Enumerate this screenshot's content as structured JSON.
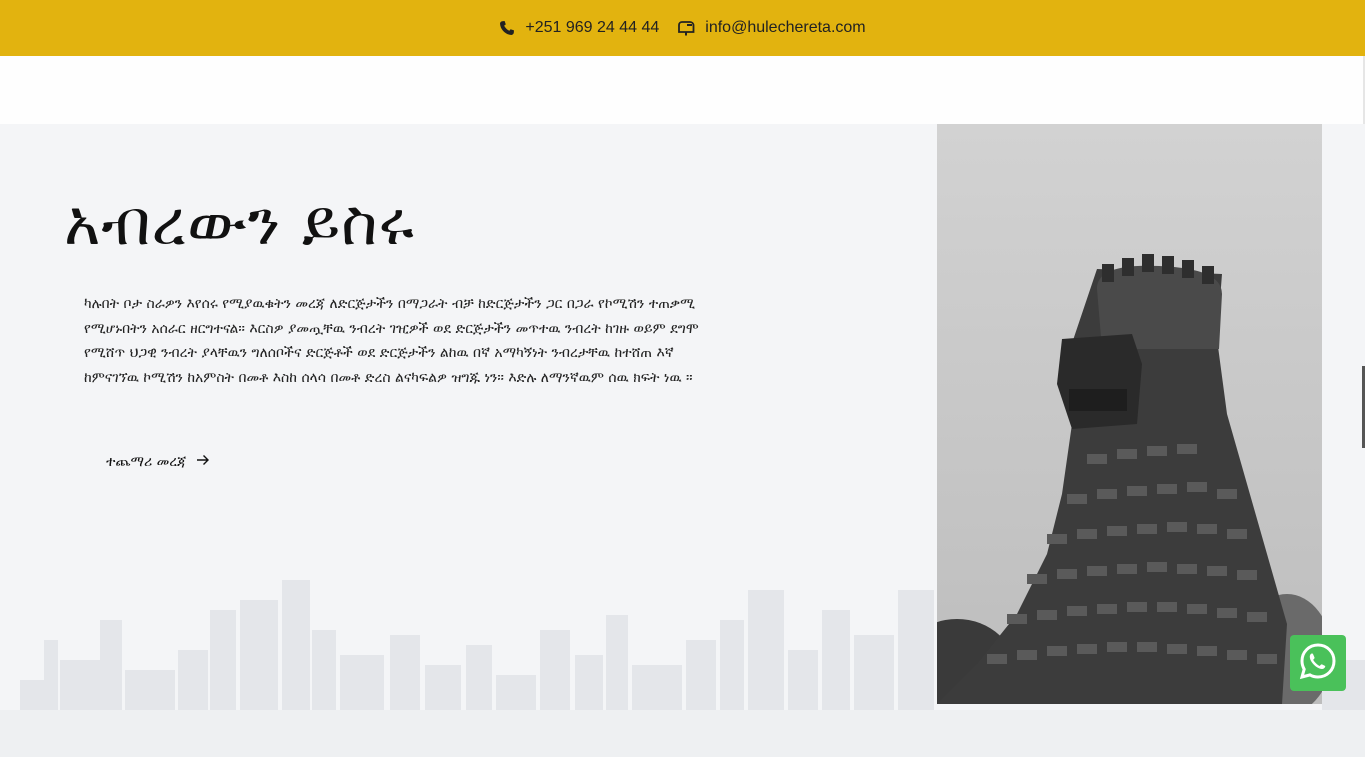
{
  "topbar": {
    "phone": "+251 969 24 44 44",
    "email": "info@hulechereta.com",
    "phone_icon": "phone-icon",
    "email_icon": "mailbox-icon",
    "background_color": "#e2b30f"
  },
  "hero": {
    "title": "አብረውን ይስሩ",
    "paragraph": "ካሉበት ቦታ ስራዎን እየሰሩ የሚያዉቁትን መረጃ ለድርጅታችን በማጋራት ብቻ ከድርጅታችን ጋር በጋራ የኮሚሽን ተጠቃሚ የሚሆኑበትን አሰራር ዘርግተናል። እርስዎ ያመጧቸዉ ንብረት ገዢዎች ወደ ድርጅታችን መጥተዉ ንብረት ከገዙ ወይም ደግሞ የሚሸጥ ህጋዊ ንብረት ያላቸዉን ግለሰቦችና ድርጅቶች ወደ ድርጅታችን ልከዉ በኛ አማካኝነት ንብረታቸዉ ከተሸጠ እኛ ከምናገኘዉ ኮሚሽን ከአምስት በመቶ እስከ ሰላሳ በመቶ ድረስ ልናካፍልዎ ዝግጁ ነን። እድሉ ለማንኛዉም ሰዉ ክፍት ነዉ ።",
    "more_link": "ተጨማሪ መረጃ",
    "more_icon": "arrow-right-icon"
  },
  "photo": {
    "subject_icon": "lion-statue-image"
  },
  "floating": {
    "whatsapp_icon": "whatsapp-icon",
    "whatsapp_color": "#4ac15a"
  }
}
